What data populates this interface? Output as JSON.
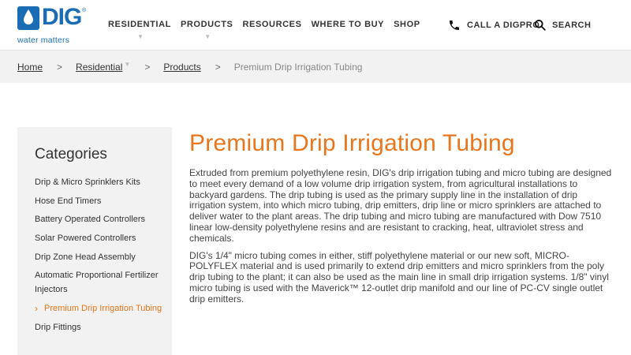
{
  "brand": {
    "name": "DIG",
    "trademark": "®",
    "tagline": "water matters",
    "color": "#1a6db5",
    "accent": "#e8761c"
  },
  "nav": {
    "items": [
      {
        "label": "RESIDENTIAL",
        "has_dropdown": true
      },
      {
        "label": "PRODUCTS",
        "has_dropdown": true
      },
      {
        "label": "RESOURCES",
        "has_dropdown": false
      },
      {
        "label": "WHERE TO BUY",
        "has_dropdown": false
      },
      {
        "label": "SHOP",
        "has_dropdown": false
      }
    ],
    "call_label": "CALL A DIGPRO",
    "call_icon": "phone-icon",
    "search_label": "SEARCH",
    "search_icon": "search-icon"
  },
  "breadcrumb": {
    "home": "Home",
    "residential": "Residential",
    "products": "Products",
    "current": "Premium Drip Irrigation Tubing",
    "separator": ">"
  },
  "sidebar": {
    "title": "Categories",
    "items": [
      {
        "label": "Drip & Micro Sprinklers Kits"
      },
      {
        "label": "Hose End Timers"
      },
      {
        "label": "Battery Operated Controllers"
      },
      {
        "label": "Solar Powered Controllers"
      },
      {
        "label": "Drip Zone Head Assembly"
      },
      {
        "label": "Automatic Proportional Fertilizer Injectors"
      },
      {
        "label": "Premium Drip Irrigation Tubing"
      },
      {
        "label": "Drip Fittings"
      }
    ]
  },
  "main": {
    "title": "Premium Drip Irrigation Tubing",
    "paragraphs": [
      "Extruded from premium polyethylene resin, DIG's drip irrigation tubing and micro tubing are designed to meet every demand of a low volume drip irrigation system, from agricultural installations to backyard gardens. The drip tubing is used as the primary supply line in the installation of drip irrigation system, into which micro tubing, drip emitters, drip line or micro sprinklers are attached to deliver water to the plant areas. The drip tubing and micro tubing are manufactured with Dow 7510 linear low-density polyethylene resins and are resistant to cracking, heat, ultraviolet stress and chemicals.",
      "DIG's 1/4\" micro tubing comes in either, stiff polyethylene material or our new soft, MICRO-POLYFLEX material and is used primarily to extend drip emitters and micro sprinklers from the poly drip tubing to the plant; it can also be used as the main line in small drip irrigation systems. 1/8\" vinyl micro tubing is used with the Maverick™ 12-outlet drip manifold and our line of PC-CV single outlet drip emitters."
    ]
  }
}
